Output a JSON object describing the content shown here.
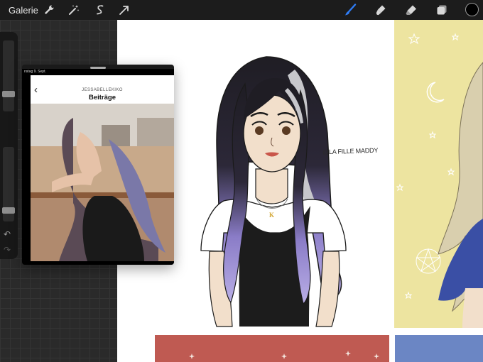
{
  "toolbar": {
    "gallery_label": "Galerie",
    "left_tools": [
      "wrench-icon",
      "magic-wand-icon",
      "selection-icon",
      "transform-arrow-icon"
    ],
    "right_tools": [
      "brush-icon",
      "smudge-icon",
      "eraser-icon",
      "layers-icon"
    ],
    "active_tool": "brush-icon",
    "accent_color": "#2f7df6",
    "current_color": "#000000"
  },
  "sidebar": {
    "brush_size_level": 0.25,
    "opacity_level": 0.15,
    "undo_icon": "undo-icon",
    "redo_icon": "redo-icon"
  },
  "reference": {
    "status_text": "nstag 9. Sept.",
    "username": "JESSABELLEKIKO",
    "title": "Beiträge",
    "back_icon": "chevron-left-icon"
  },
  "canvas": {
    "watermark": "@LA FILLE MADDY"
  }
}
